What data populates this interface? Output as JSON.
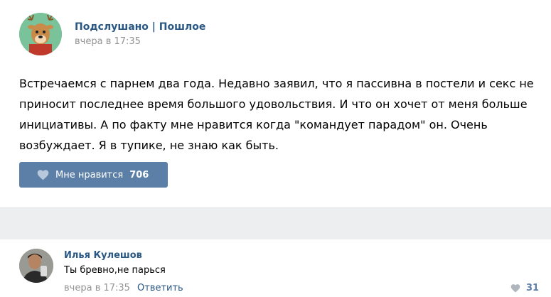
{
  "post": {
    "group_name": "Подслушано | Пошлое",
    "time": "вчера в 17:35",
    "text": "Встречаемся с парнем два года. Недавно заявил, что я пассивна в постели и секс не приносит последнее время большого удовольствия. И что он хочет от меня больше инициативы. А по факту мне нравится когда \"командует парадом\" он. Очень возбуждает. Я в тупике, не знаю как быть.",
    "like": {
      "label": "Мне нравится",
      "count": "706"
    }
  },
  "comment": {
    "author": "Илья Кулешов",
    "text": "Ты бревно,не парься",
    "time": "вчера в 17:35",
    "reply_label": "Ответить",
    "like_count": "31"
  },
  "icons": {
    "group_avatar": "deer-avatar-icon",
    "user_avatar": "user-photo-avatar",
    "like": "heart-icon"
  },
  "colors": {
    "link": "#2a5885",
    "like_button": "#5b7fa6",
    "muted": "#939393",
    "separator": "#edeef0"
  }
}
